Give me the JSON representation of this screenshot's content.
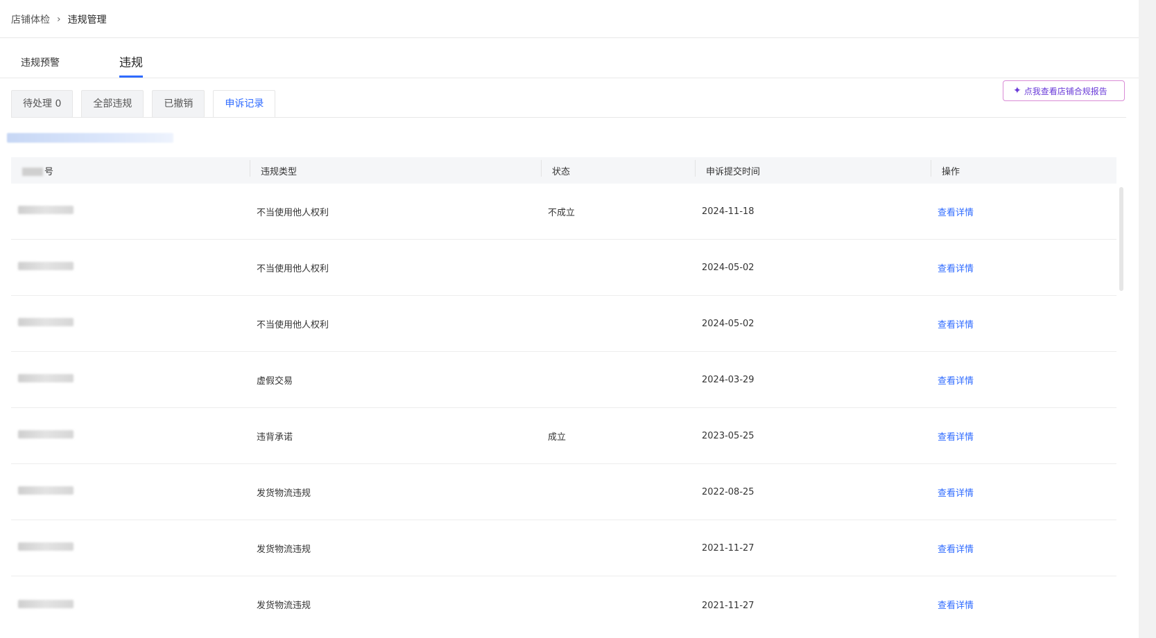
{
  "breadcrumb": {
    "home": "店铺体检",
    "separator": "›",
    "current": "违规管理"
  },
  "main_tabs": [
    {
      "label": "违规预警"
    },
    {
      "label": "违规"
    }
  ],
  "sub_tabs": [
    {
      "label": "待处理 0"
    },
    {
      "label": "全部违规"
    },
    {
      "label": "已撤销"
    },
    {
      "label": "申诉记录"
    }
  ],
  "report_button": {
    "label": "点我查看店铺合规报告"
  },
  "table": {
    "headers": [
      "号",
      "违规类型",
      "状态",
      "申诉提交时间",
      "操作"
    ],
    "rows": [
      {
        "type": "不当使用他人权利",
        "status": "不成立",
        "date": "2024-11-18",
        "action": "查看详情"
      },
      {
        "type": "不当使用他人权利",
        "status": "",
        "date": "2024-05-02",
        "action": "查看详情"
      },
      {
        "type": "不当使用他人权利",
        "status": "",
        "date": "2024-05-02",
        "action": "查看详情"
      },
      {
        "type": "虚假交易",
        "status": "",
        "date": "2024-03-29",
        "action": "查看详情"
      },
      {
        "type": "违背承诺",
        "status": "成立",
        "date": "2023-05-25",
        "action": "查看详情"
      },
      {
        "type": "发货物流违规",
        "status": "",
        "date": "2022-08-25",
        "action": "查看详情"
      },
      {
        "type": "发货物流违规",
        "status": "",
        "date": "2021-11-27",
        "action": "查看详情"
      },
      {
        "type": "发货物流违规",
        "status": "",
        "date": "2021-11-27",
        "action": "查看详情"
      }
    ]
  }
}
